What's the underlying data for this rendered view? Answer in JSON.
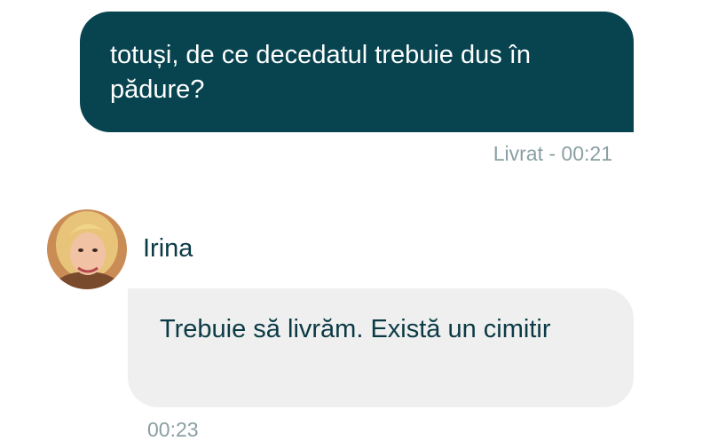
{
  "outgoing": {
    "text": "totuși, de ce decedatul trebuie dus în pădure?",
    "status": "Livrat - 00:21"
  },
  "incoming": {
    "sender_name": "Irina",
    "avatar_icon": "user-avatar-photo",
    "text": "Trebuie să livrăm. Există un cimitir",
    "time": "00:23"
  },
  "colors": {
    "outgoing_bubble": "#07444f",
    "incoming_bubble": "#efefef",
    "primary_text": "#0b3a45",
    "meta_text": "#8a9fa3"
  }
}
